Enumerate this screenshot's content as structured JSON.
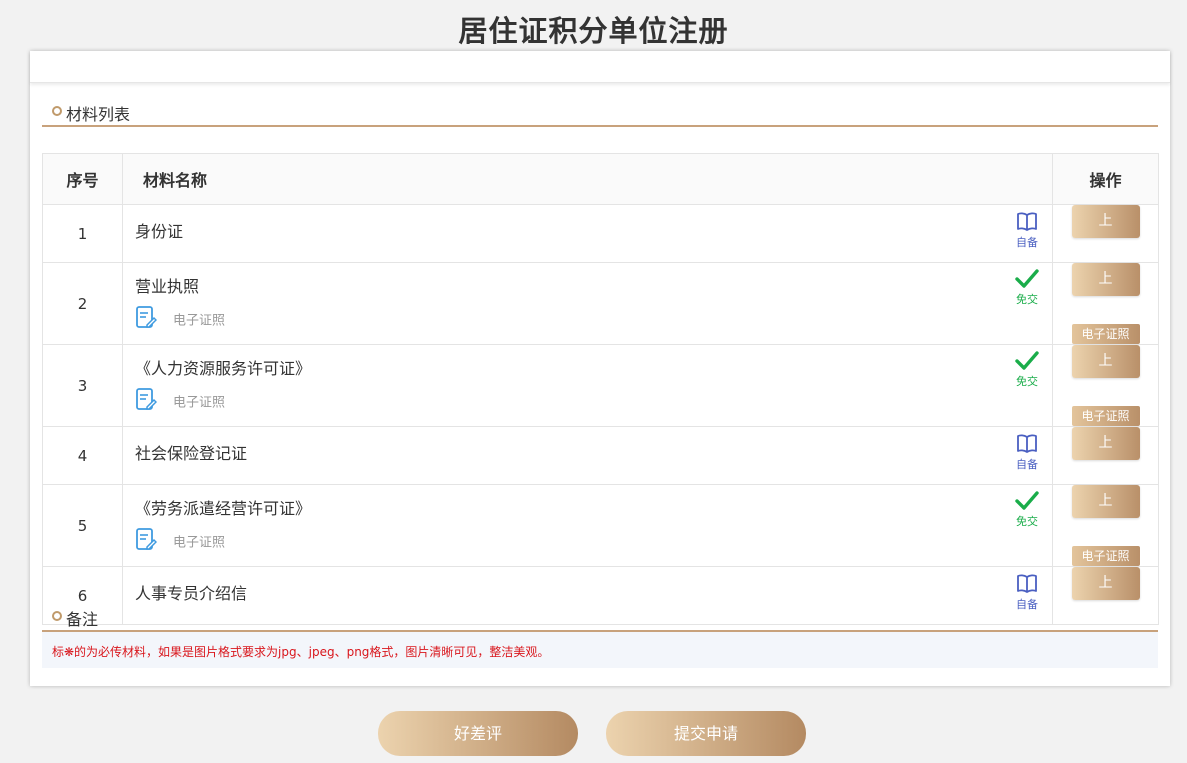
{
  "page": {
    "title": "居住证积分单位注册"
  },
  "sections": {
    "materials": "材料列表",
    "notes": "备注"
  },
  "table": {
    "headers": {
      "index": "序号",
      "name": "材料名称",
      "ops": "操作"
    },
    "rows": [
      {
        "index": "1",
        "name": "身份证",
        "status": "自备",
        "status_icon": "book-icon",
        "sub": "",
        "upload": "上传",
        "econ": ""
      },
      {
        "index": "2",
        "name": "营业执照",
        "status": "免交",
        "status_icon": "check-icon",
        "sub": "电子证照",
        "upload": "上传",
        "econ": "电子证照"
      },
      {
        "index": "3",
        "name": "《人力资源服务许可证》",
        "status": "免交",
        "status_icon": "check-icon",
        "sub": "电子证照",
        "upload": "上传",
        "econ": "电子证照"
      },
      {
        "index": "4",
        "name": "社会保险登记证",
        "status": "自备",
        "status_icon": "book-icon",
        "sub": "",
        "upload": "上传",
        "econ": ""
      },
      {
        "index": "5",
        "name": "《劳务派遣经营许可证》",
        "status": "免交",
        "status_icon": "check-icon",
        "sub": "电子证照",
        "upload": "上传",
        "econ": "电子证照"
      },
      {
        "index": "6",
        "name": "人事专员介绍信",
        "status": "自备",
        "status_icon": "book-icon",
        "sub": "",
        "upload": "上传",
        "econ": ""
      }
    ]
  },
  "note": {
    "text": "标❋的为必传材料，如果是图片格式要求为jpg、jpeg、png格式，图片清晰可见，整洁美观。"
  },
  "footer": {
    "review_label": "好差评",
    "submit_label": "提交申请"
  },
  "colors": {
    "accent_gold": "#c8a27c",
    "self_prepared_blue": "#4a5fc1",
    "exempt_green": "#1aad4a",
    "note_red": "#d9161c"
  }
}
